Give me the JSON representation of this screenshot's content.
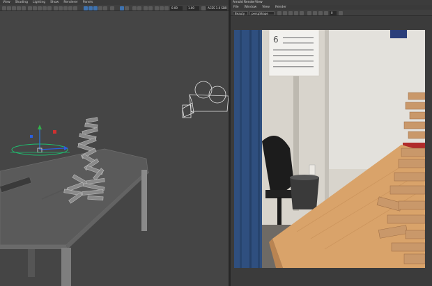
{
  "viewport": {
    "menu": [
      "View",
      "Shading",
      "Lighting",
      "Show",
      "Renderer",
      "Panels"
    ],
    "fields": {
      "near": "0.00",
      "far": "1.00",
      "color_space": "ACES 1.0 SDR-vid..."
    }
  },
  "render_view": {
    "window_title": "Arnold RenderView",
    "menu": [
      "File",
      "Window",
      "View",
      "Render"
    ],
    "aov_dropdown": "Beauty",
    "camera_dropdown": "perspShape",
    "exposure_field": "0"
  },
  "render_image": {
    "calendar_number": "6"
  },
  "colors": {
    "panel_bg": "#3a3a3a",
    "viewport_bg": "#454545",
    "highlight": "#3f73b0",
    "wall": "#d9d6cf",
    "curtain": "#2f4f7f",
    "table_wood": "#d9a36a"
  }
}
